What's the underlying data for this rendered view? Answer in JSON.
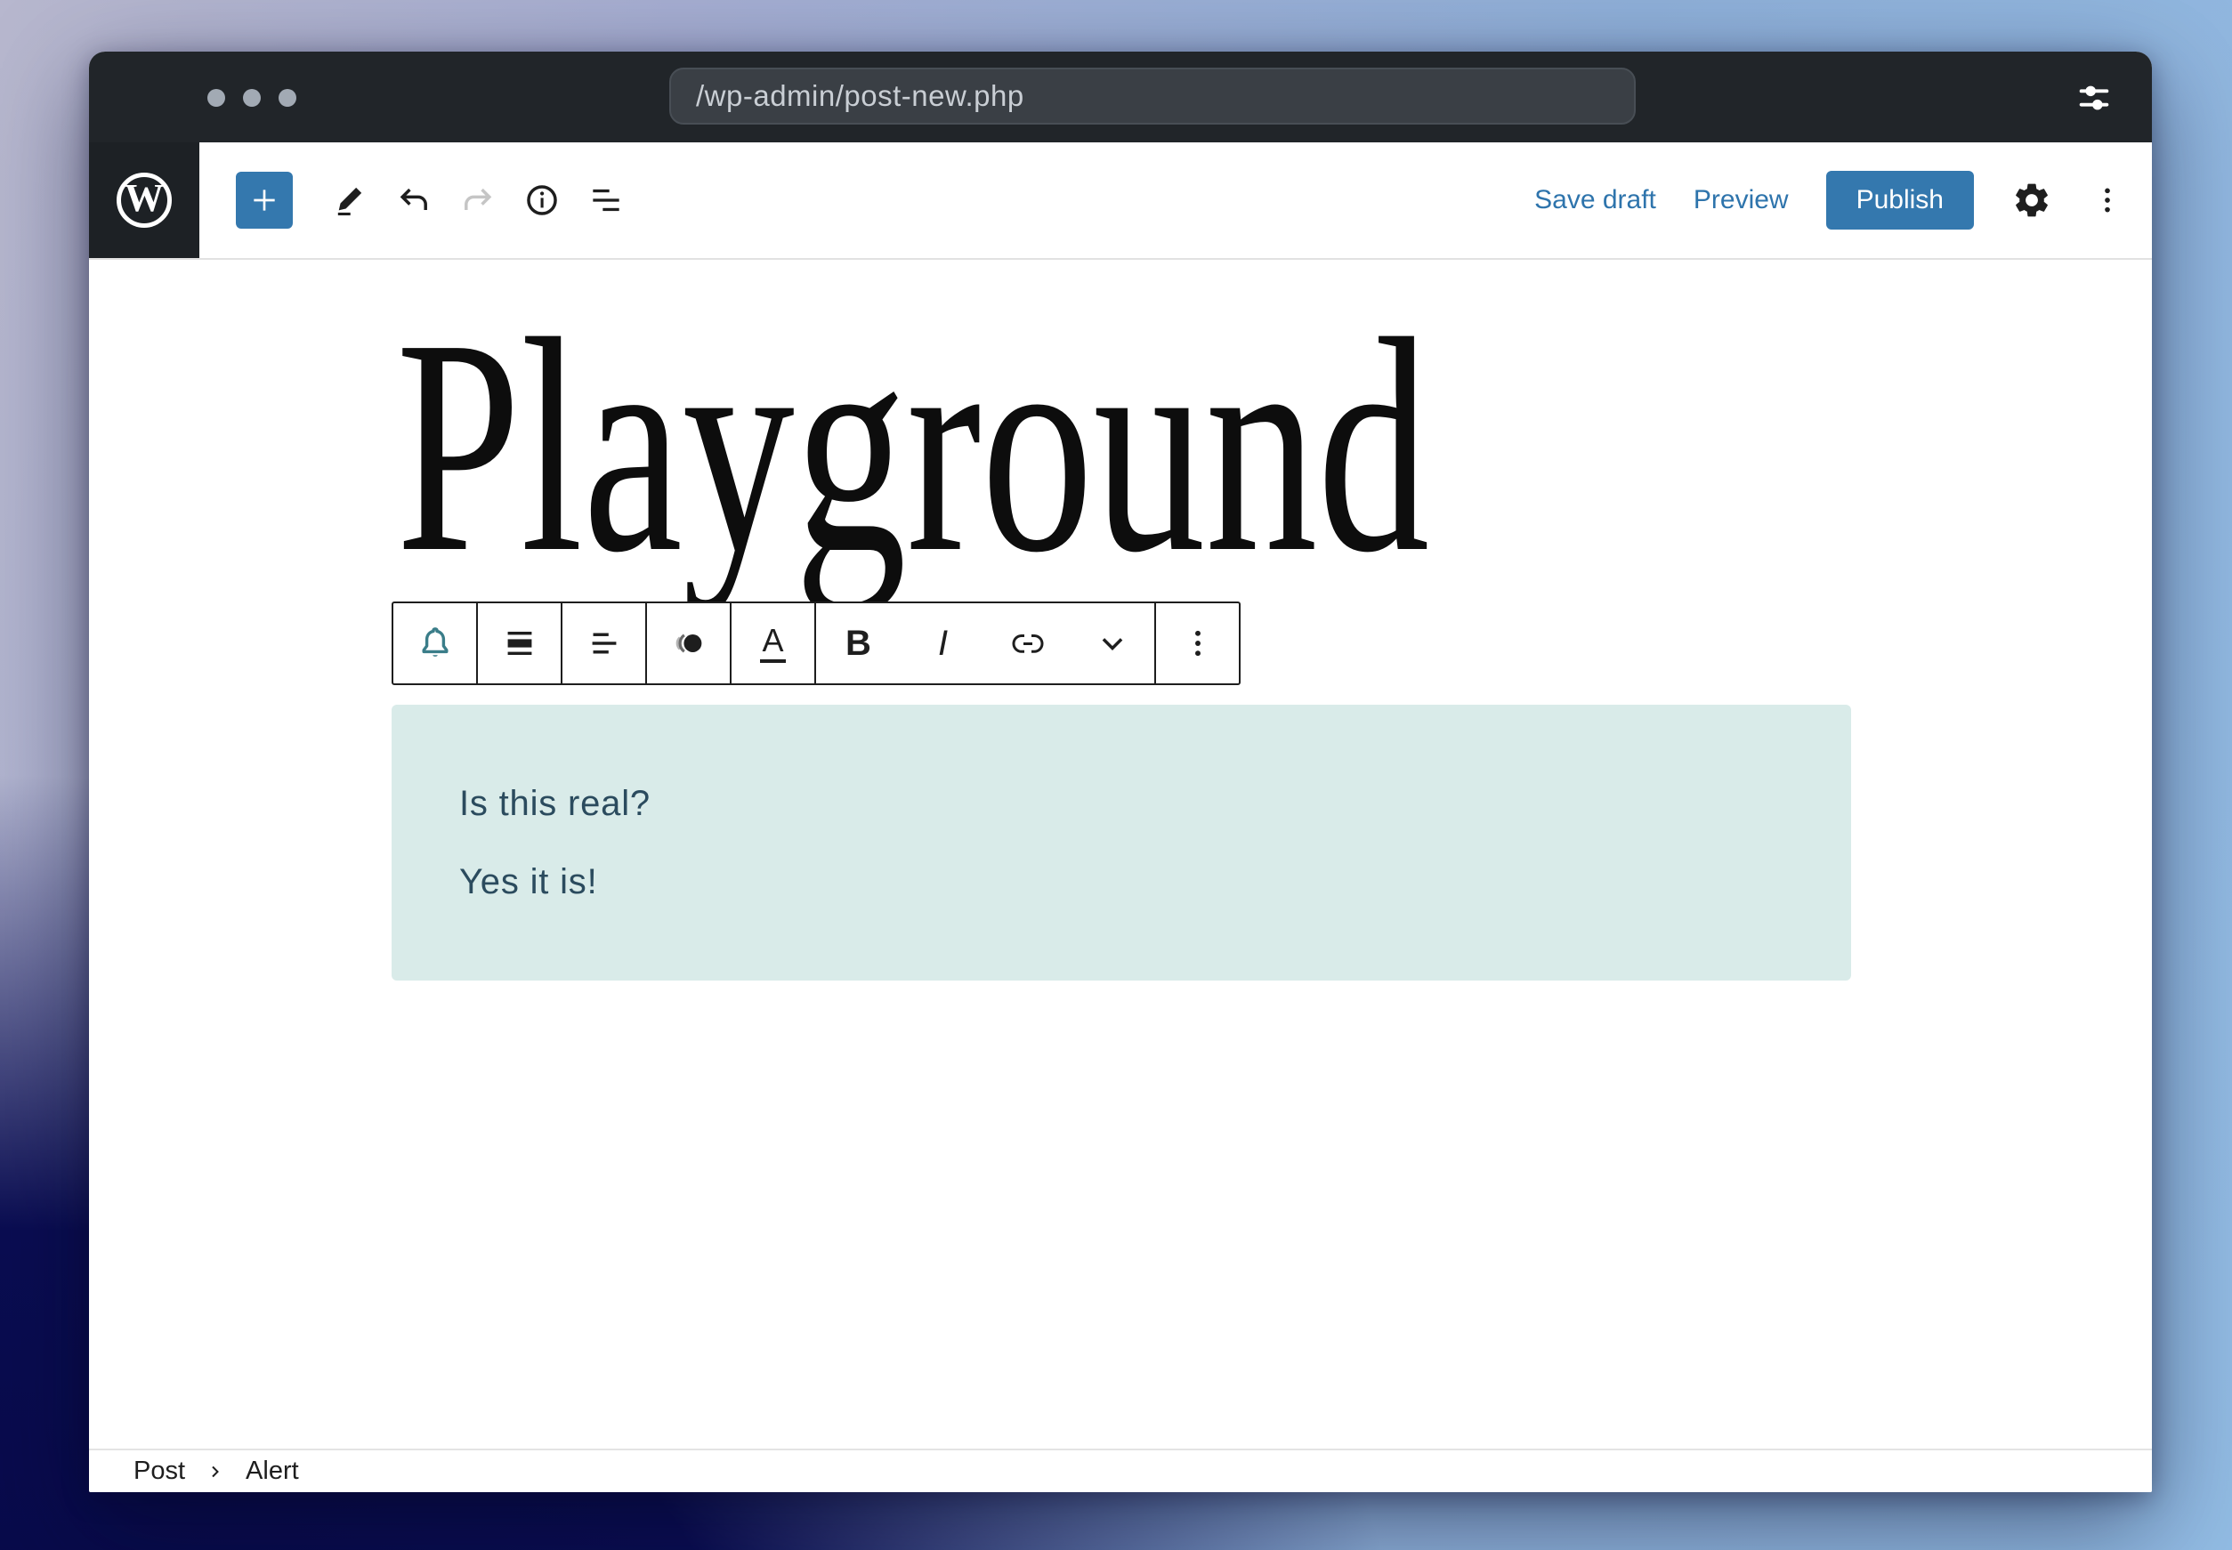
{
  "titlebar": {
    "url": "/wp-admin/post-new.php"
  },
  "header": {
    "logo_letter": "W",
    "save_draft_label": "Save draft",
    "preview_label": "Preview",
    "publish_label": "Publish"
  },
  "content": {
    "post_title": "Playground"
  },
  "block_toolbar": {
    "bold_label": "B",
    "italic_label": "I",
    "text_color_label": "A"
  },
  "alert_block": {
    "line1": "Is this real?",
    "line2": "Yes it is!"
  },
  "breadcrumb": {
    "root": "Post",
    "current": "Alert"
  },
  "icons": {
    "titlebar": [
      "window-dots",
      "sliders-icon"
    ],
    "header_left": [
      "wordpress-logo",
      "inserter-plus-icon",
      "pencil-icon",
      "undo-icon",
      "redo-icon",
      "info-icon",
      "list-view-icon"
    ],
    "header_right": [
      "gear-icon",
      "kebab-menu-icon"
    ],
    "block_toolbar": [
      "bell-icon",
      "block-align-icon",
      "text-align-icon",
      "contrast-icon",
      "text-color-icon",
      "bold-icon",
      "italic-icon",
      "link-icon",
      "chevron-down-icon",
      "kebab-menu-icon"
    ],
    "breadcrumb": [
      "chevron-right-icon"
    ]
  },
  "colors": {
    "accent_blue": "#3478ae",
    "link_blue": "#2e74ac",
    "titlebar_bg": "#212529",
    "alert_bg": "#d9ebe9",
    "alert_text": "#2b4b5e",
    "bell_teal": "#3a7d89"
  }
}
